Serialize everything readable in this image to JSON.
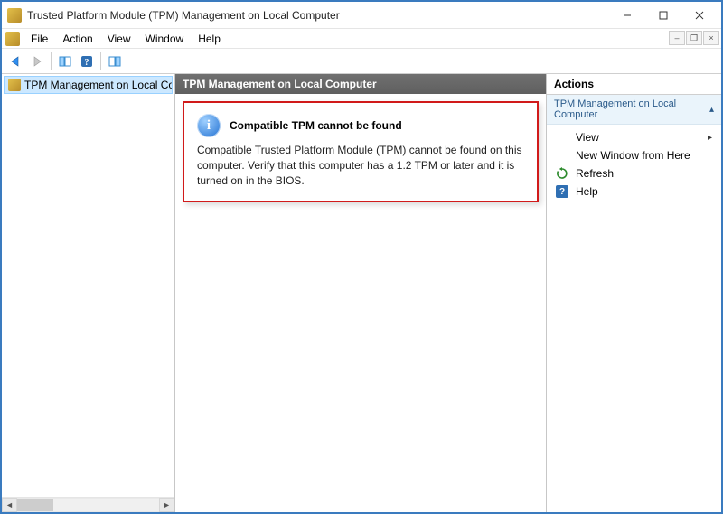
{
  "window": {
    "title": "Trusted Platform Module (TPM) Management on Local Computer"
  },
  "menu": {
    "file": "File",
    "action": "Action",
    "view": "View",
    "window": "Window",
    "help": "Help"
  },
  "tree": {
    "selected_label": "TPM Management on Local Comp"
  },
  "center": {
    "header": "TPM Management on Local Computer",
    "alert_title": "Compatible TPM cannot be found",
    "alert_body": "Compatible Trusted Platform Module (TPM) cannot be found on this computer. Verify that this computer has a 1.2 TPM or later and it is turned on in the BIOS."
  },
  "actions": {
    "header": "Actions",
    "group_title": "TPM Management on Local Computer",
    "view": "View",
    "new_window": "New Window from Here",
    "refresh": "Refresh",
    "help": "Help"
  }
}
